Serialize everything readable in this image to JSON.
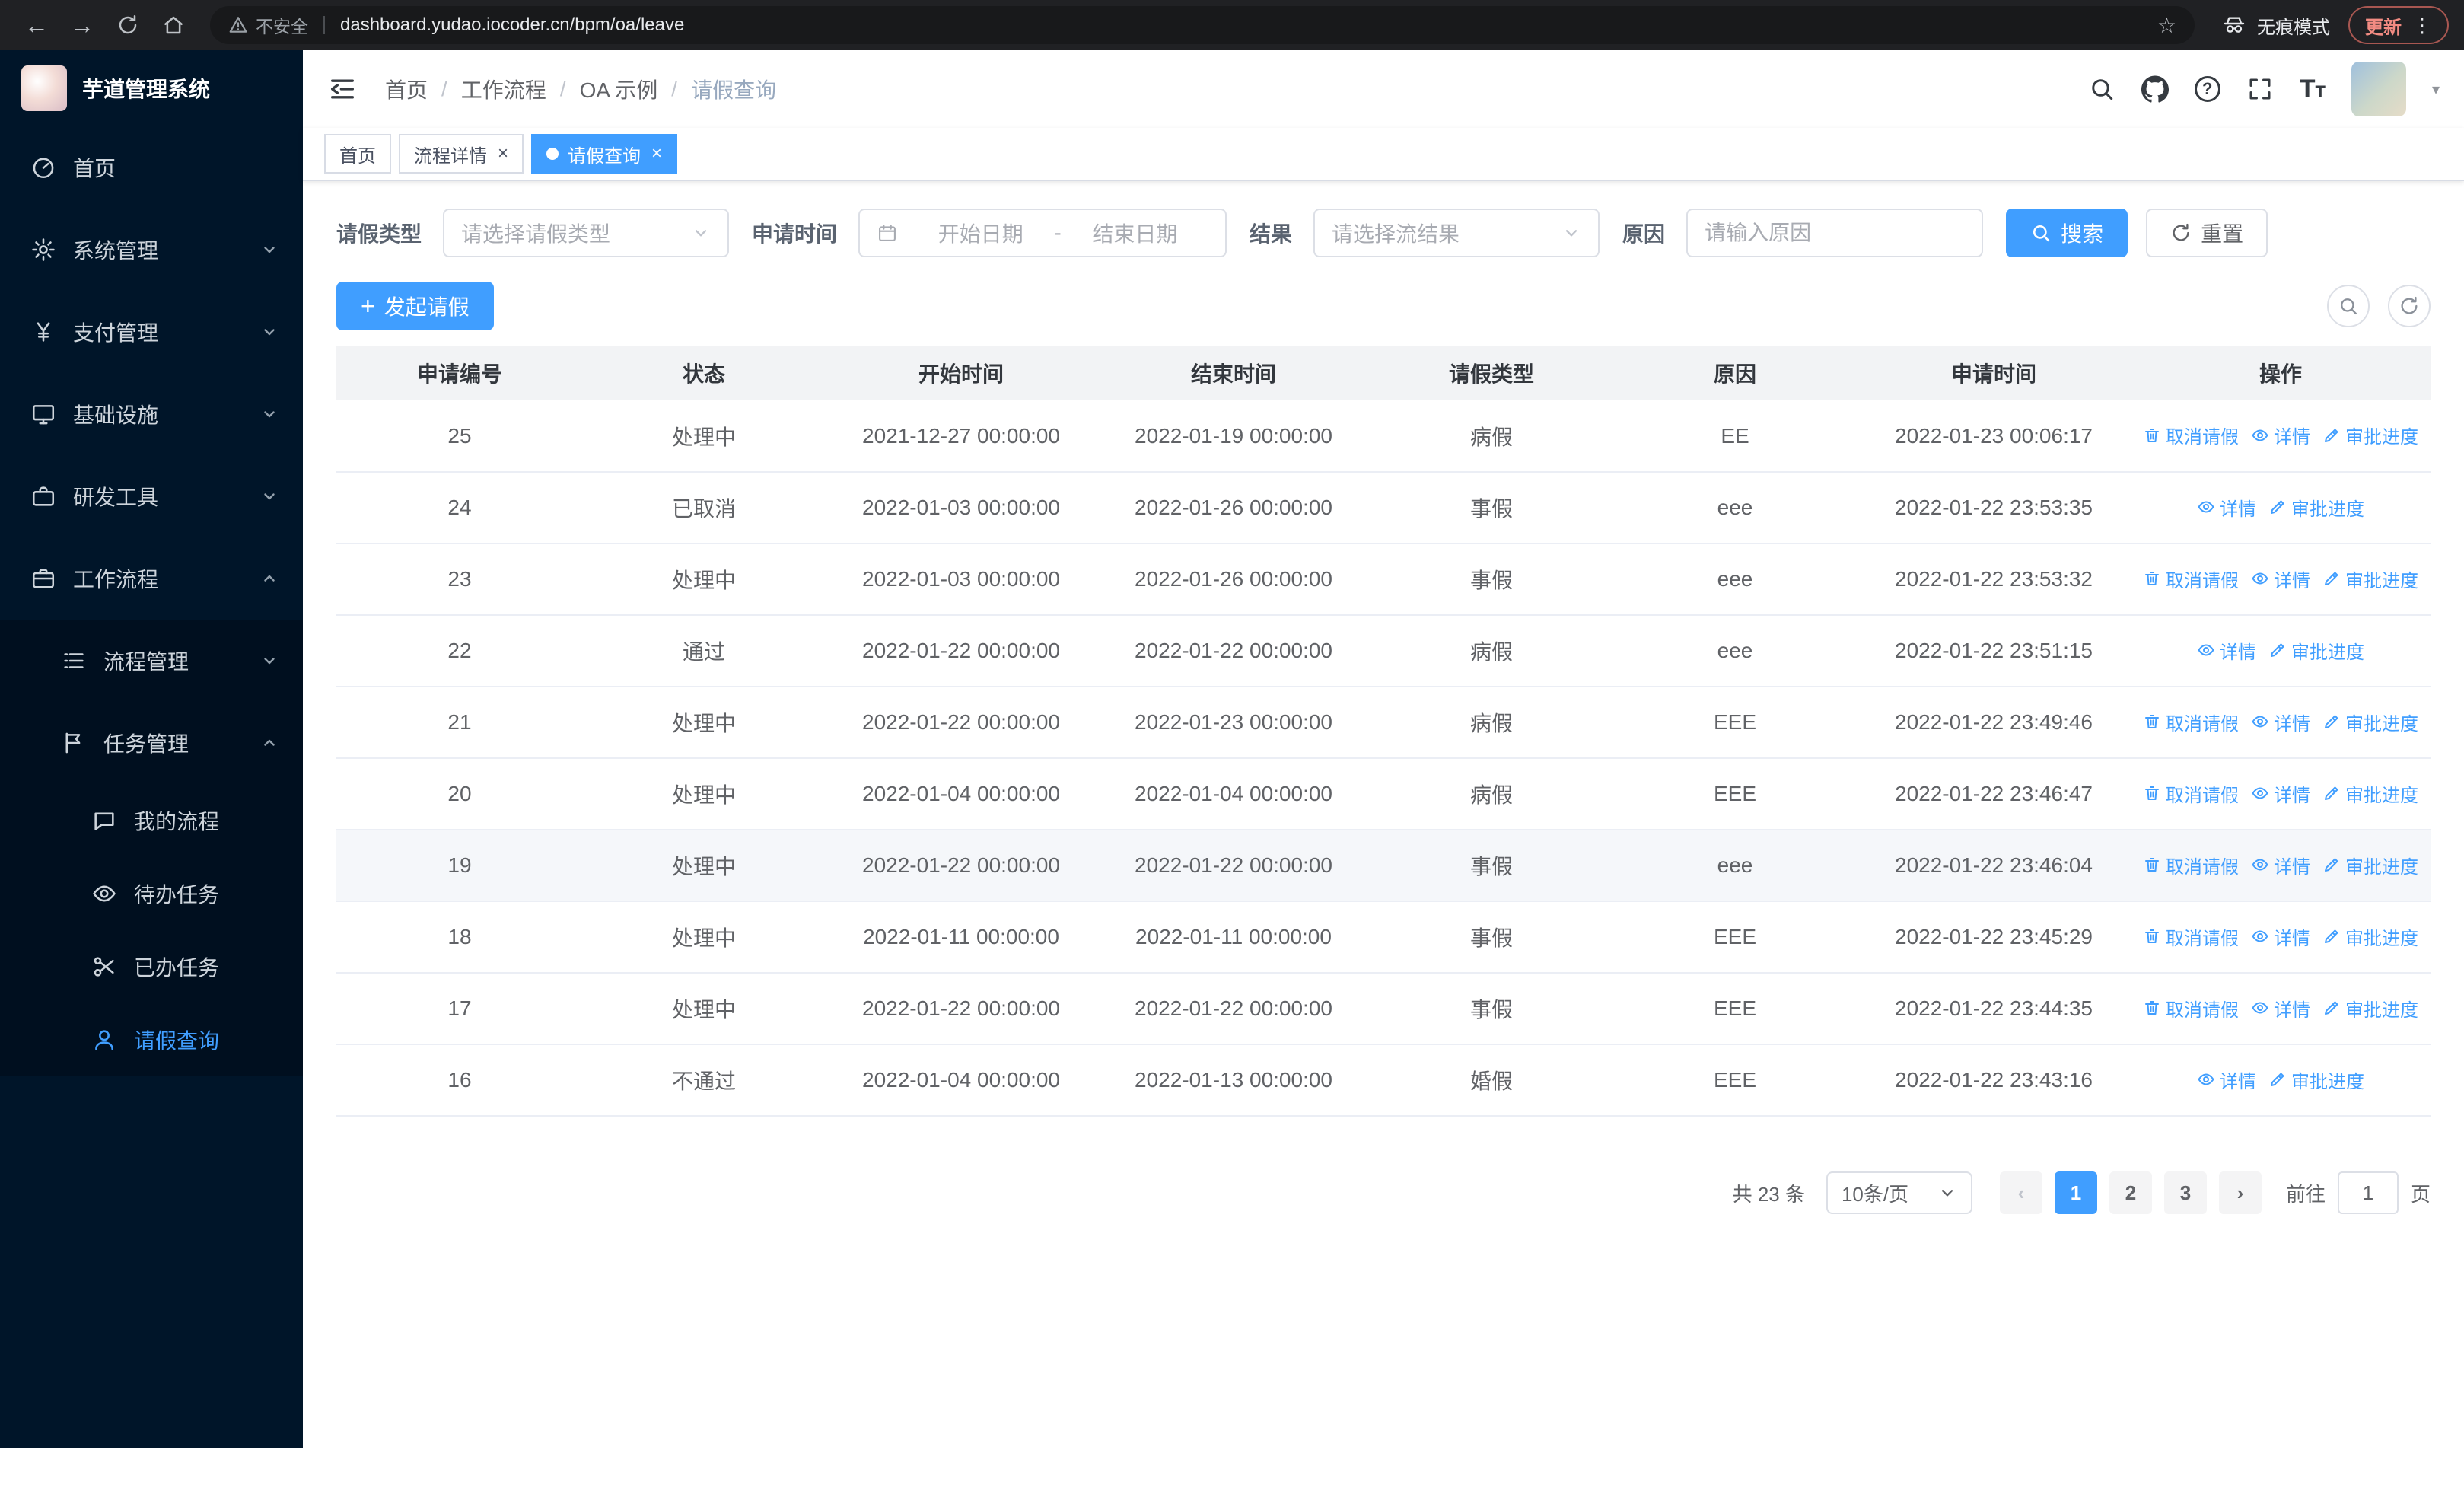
{
  "browser": {
    "security_warning": "不安全",
    "url": "dashboard.yudao.iocoder.cn/bpm/oa/leave",
    "incognito_label": "无痕模式",
    "update_button": "更新"
  },
  "icons": {
    "back": "←",
    "forward": "→",
    "star": "☆",
    "menu_dots": "⋮",
    "close": "×",
    "plus": "+",
    "prev": "‹",
    "next": "›",
    "caret": "▾",
    "question": "?",
    "tsize_big": "T",
    "tsize_small": "T"
  },
  "sidebar": {
    "logo_title": "芋道管理系统",
    "items": [
      {
        "label": "首页"
      },
      {
        "label": "系统管理"
      },
      {
        "label": "支付管理"
      },
      {
        "label": "基础设施"
      },
      {
        "label": "研发工具"
      },
      {
        "label": "工作流程"
      },
      {
        "label": "流程管理"
      },
      {
        "label": "任务管理"
      },
      {
        "label": "我的流程"
      },
      {
        "label": "待办任务"
      },
      {
        "label": "已办任务"
      },
      {
        "label": "请假查询"
      }
    ]
  },
  "header": {
    "breadcrumb": [
      {
        "label": "首页"
      },
      {
        "label": "工作流程"
      },
      {
        "label": "OA 示例"
      },
      {
        "label": "请假查询"
      }
    ]
  },
  "tabs": [
    {
      "label": "首页"
    },
    {
      "label": "流程详情"
    },
    {
      "label": "请假查询"
    }
  ],
  "filters": {
    "leave_type_label": "请假类型",
    "leave_type_placeholder": "请选择请假类型",
    "apply_time_label": "申请时间",
    "start_date_placeholder": "开始日期",
    "date_separator": "-",
    "end_date_placeholder": "结束日期",
    "result_label": "结果",
    "result_placeholder": "请选择流结果",
    "reason_label": "原因",
    "reason_placeholder": "请输入原因",
    "search_button": "搜索",
    "reset_button": "重置"
  },
  "toolbar": {
    "create_button": "发起请假"
  },
  "table": {
    "columns": [
      "申请编号",
      "状态",
      "开始时间",
      "结束时间",
      "请假类型",
      "原因",
      "申请时间",
      "操作"
    ],
    "actions": {
      "cancel": "取消请假",
      "detail": "详情",
      "progress": "审批进度"
    },
    "rows": [
      {
        "id": "25",
        "status": "处理中",
        "start": "2021-12-27 00:00:00",
        "end": "2022-01-19 00:00:00",
        "type": "病假",
        "reason": "EE",
        "applied": "2022-01-23 00:06:17",
        "cancellable": true,
        "highlighted": false
      },
      {
        "id": "24",
        "status": "已取消",
        "start": "2022-01-03 00:00:00",
        "end": "2022-01-26 00:00:00",
        "type": "事假",
        "reason": "eee",
        "applied": "2022-01-22 23:53:35",
        "cancellable": false,
        "highlighted": false
      },
      {
        "id": "23",
        "status": "处理中",
        "start": "2022-01-03 00:00:00",
        "end": "2022-01-26 00:00:00",
        "type": "事假",
        "reason": "eee",
        "applied": "2022-01-22 23:53:32",
        "cancellable": true,
        "highlighted": false
      },
      {
        "id": "22",
        "status": "通过",
        "start": "2022-01-22 00:00:00",
        "end": "2022-01-22 00:00:00",
        "type": "病假",
        "reason": "eee",
        "applied": "2022-01-22 23:51:15",
        "cancellable": false,
        "highlighted": false
      },
      {
        "id": "21",
        "status": "处理中",
        "start": "2022-01-22 00:00:00",
        "end": "2022-01-23 00:00:00",
        "type": "病假",
        "reason": "EEE",
        "applied": "2022-01-22 23:49:46",
        "cancellable": true,
        "highlighted": false
      },
      {
        "id": "20",
        "status": "处理中",
        "start": "2022-01-04 00:00:00",
        "end": "2022-01-04 00:00:00",
        "type": "病假",
        "reason": "EEE",
        "applied": "2022-01-22 23:46:47",
        "cancellable": true,
        "highlighted": false
      },
      {
        "id": "19",
        "status": "处理中",
        "start": "2022-01-22 00:00:00",
        "end": "2022-01-22 00:00:00",
        "type": "事假",
        "reason": "eee",
        "applied": "2022-01-22 23:46:04",
        "cancellable": true,
        "highlighted": true
      },
      {
        "id": "18",
        "status": "处理中",
        "start": "2022-01-11 00:00:00",
        "end": "2022-01-11 00:00:00",
        "type": "事假",
        "reason": "EEE",
        "applied": "2022-01-22 23:45:29",
        "cancellable": true,
        "highlighted": false
      },
      {
        "id": "17",
        "status": "处理中",
        "start": "2022-01-22 00:00:00",
        "end": "2022-01-22 00:00:00",
        "type": "事假",
        "reason": "EEE",
        "applied": "2022-01-22 23:44:35",
        "cancellable": true,
        "highlighted": false
      },
      {
        "id": "16",
        "status": "不通过",
        "start": "2022-01-04 00:00:00",
        "end": "2022-01-13 00:00:00",
        "type": "婚假",
        "reason": "EEE",
        "applied": "2022-01-22 23:43:16",
        "cancellable": false,
        "highlighted": false
      }
    ]
  },
  "pagination": {
    "total_text": "共 23 条",
    "page_size": "10条/页",
    "pages": [
      "1",
      "2",
      "3"
    ],
    "current_page": "1",
    "goto_label": "前往",
    "goto_value": "1",
    "page_suffix": "页"
  },
  "colors": {
    "primary": "#409eff",
    "sidebar_bg": "#001529"
  }
}
